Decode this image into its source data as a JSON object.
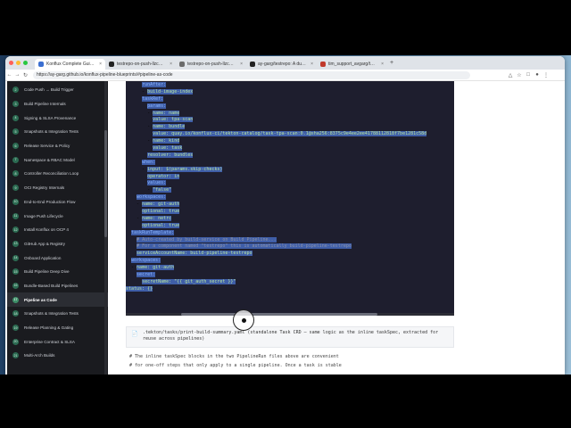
{
  "browser": {
    "tabs": [
      {
        "label": "Konflux Complete Guide — E",
        "color": "#3b6fd1",
        "active": true
      },
      {
        "label": "testrepo-on-push-llzcq – Dri",
        "color": "#222222",
        "active": false
      },
      {
        "label": "testrepo-on-push-llzcq – Dri",
        "color": "#6b6b6b",
        "active": false
      },
      {
        "label": "ay-garg/testrepo: A dummy",
        "color": "#222222",
        "active": false
      },
      {
        "label": "tim_support_avgarg/testrep",
        "color": "#c0392b",
        "active": false
      }
    ],
    "close_glyph": "×",
    "newtab_glyph": "+",
    "url": "https://ay-garg.github.io/konflux-pipeline-blueprints/#pipeline-as-code"
  },
  "sidebar": {
    "items": [
      {
        "num": "2",
        "label": "Code Push → Build Trigger"
      },
      {
        "num": "3",
        "label": "Build Pipeline Internals"
      },
      {
        "num": "4",
        "label": "Signing & SLSA Provenance"
      },
      {
        "num": "5",
        "label": "Snapshots & Integration Tests"
      },
      {
        "num": "6",
        "label": "Release Service & Policy"
      },
      {
        "num": "7",
        "label": "Namespace & RBAC Model"
      },
      {
        "num": "8",
        "label": "Controller Reconciliation Loop"
      },
      {
        "num": "9",
        "label": "OCI Registry Internals"
      },
      {
        "num": "10",
        "label": "End-to-End Production Flow"
      },
      {
        "num": "11",
        "label": "Image Push Lifecycle"
      },
      {
        "num": "12",
        "label": "Install Konflux on OCP 4"
      },
      {
        "num": "13",
        "label": "GitHub App & Registry"
      },
      {
        "num": "14",
        "label": "Onboard Application"
      },
      {
        "num": "15",
        "label": "Build Pipeline Deep Dive"
      },
      {
        "num": "16",
        "label": "Bundle-Based Build Pipelines"
      },
      {
        "num": "17",
        "label": "Pipeline as Code",
        "active": true
      },
      {
        "num": "18",
        "label": "Snapshots & Integration Tests"
      },
      {
        "num": "19",
        "label": "Release Planning & Gating"
      },
      {
        "num": "20",
        "label": "Enterprise Contract & SLSA"
      },
      {
        "num": "21",
        "label": "Multi-Arch Builds"
      }
    ]
  },
  "code": {
    "lines": [
      {
        "indent": "      ",
        "text": "runAfter:",
        "cls": "k"
      },
      {
        "indent": "      - ",
        "text": "build-image-index",
        "cls": "s"
      },
      {
        "indent": "      ",
        "text": "taskRef:",
        "cls": "k"
      },
      {
        "indent": "        ",
        "text": "params:",
        "cls": "k"
      },
      {
        "indent": "        - ",
        "text": "name: name",
        "cls": "s"
      },
      {
        "indent": "          ",
        "text": "value: tpa-scan",
        "cls": "s"
      },
      {
        "indent": "        - ",
        "text": "name: bundle",
        "cls": "s"
      },
      {
        "indent": "          ",
        "text": "value: quay.io/konflux-ci/tekton-catalog/task-tpa-scan:0.1@sha256:8375c9e4ee2ee41788112818f7be1281c58d",
        "cls": "s"
      },
      {
        "indent": "        - ",
        "text": "name: kind",
        "cls": "s"
      },
      {
        "indent": "          ",
        "text": "value: task",
        "cls": "s"
      },
      {
        "indent": "        ",
        "text": "resolver: bundles",
        "cls": "s"
      },
      {
        "indent": "      ",
        "text": "when:",
        "cls": "k"
      },
      {
        "indent": "      - ",
        "text": "input: $(params.skip-checks)",
        "cls": "s"
      },
      {
        "indent": "        ",
        "text": "operator: in",
        "cls": "s"
      },
      {
        "indent": "        ",
        "text": "values:",
        "cls": "k"
      },
      {
        "indent": "        - ",
        "text": "\"false\"",
        "cls": "s"
      },
      {
        "indent": "    ",
        "text": "workspaces:",
        "cls": "k"
      },
      {
        "indent": "    - ",
        "text": "name: git-auth",
        "cls": "s"
      },
      {
        "indent": "      ",
        "text": "optional: true",
        "cls": "s"
      },
      {
        "indent": "    - ",
        "text": "name: netrc",
        "cls": "s"
      },
      {
        "indent": "      ",
        "text": "optional: true",
        "cls": "s"
      },
      {
        "indent": "  ",
        "text": "taskRunTemplate:",
        "cls": "k"
      },
      {
        "indent": "    ",
        "text": "# Auto-created by build-service on Build Pipeline...",
        "cls": "c"
      },
      {
        "indent": "    ",
        "text": "# For a component named \"testrepo\" this is automatically build-pipeline-testrepo",
        "cls": "c"
      },
      {
        "indent": "    ",
        "text": "serviceAccountName: build-pipeline-testrepo",
        "cls": "s"
      },
      {
        "indent": "  ",
        "text": "workspaces:",
        "cls": "k"
      },
      {
        "indent": "  - ",
        "text": "name: git-auth",
        "cls": "s"
      },
      {
        "indent": "    ",
        "text": "secret:",
        "cls": "k"
      },
      {
        "indent": "      ",
        "text": "secretName: \"{{ git_auth_secret }}\"",
        "cls": "s"
      },
      {
        "indent": "",
        "text": "status: {}",
        "cls": "s"
      }
    ]
  },
  "file_header": {
    "icon": "file-icon",
    "text": ".tekton/tasks/print-build-summary.yaml (standalone Task CRD — same logic as the inline taskSpec, extracted for reuse across pipelines)"
  },
  "comments": {
    "line1": "# The inline taskSpec blocks in the two PipelineRun files above are convenient",
    "line2": "# for one-off steps that only apply to a single pipeline. Once a task is stable"
  }
}
